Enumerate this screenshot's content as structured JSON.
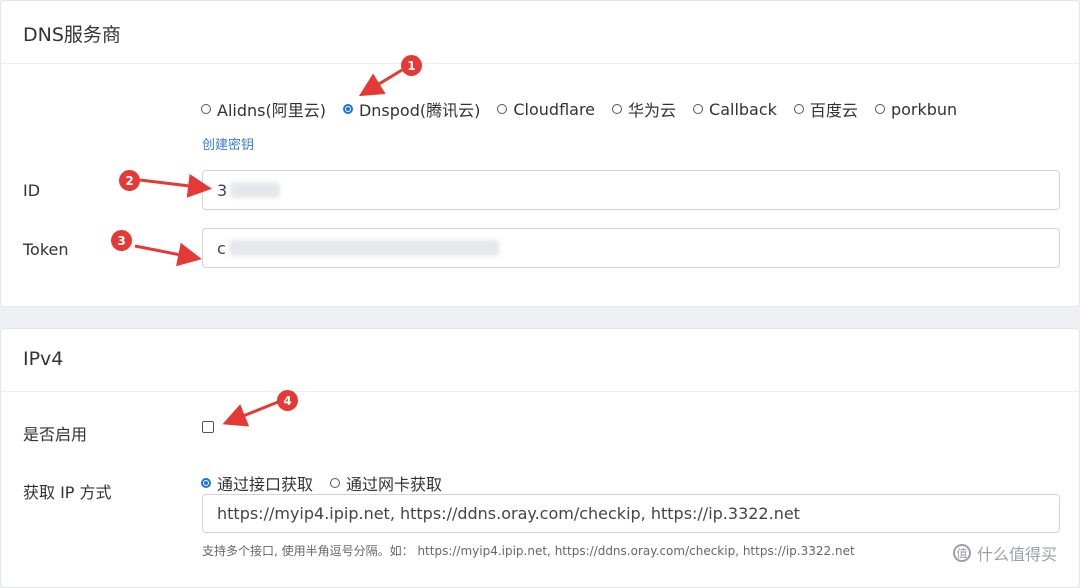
{
  "dns_card": {
    "title": "DNS服务商",
    "providers": [
      {
        "label": "Alidns(阿里云)",
        "checked": false
      },
      {
        "label": "Dnspod(腾讯云)",
        "checked": true
      },
      {
        "label": "Cloudflare",
        "checked": false
      },
      {
        "label": "华为云",
        "checked": false
      },
      {
        "label": "Callback",
        "checked": false
      },
      {
        "label": "百度云",
        "checked": false
      },
      {
        "label": "porkbun",
        "checked": false
      }
    ],
    "create_key_link": "创建密钥",
    "id_label": "ID",
    "id_value": "3",
    "token_label": "Token",
    "token_value": "c"
  },
  "ipv4_card": {
    "title": "IPv4",
    "enable_label": "是否启用",
    "enabled": false,
    "method_label": "获取 IP 方式",
    "methods": [
      {
        "label": "通过接口获取",
        "checked": true
      },
      {
        "label": "通过网卡获取",
        "checked": false
      }
    ],
    "url_value": "https://myip4.ipip.net, https://ddns.oray.com/checkip, https://ip.3322.net",
    "help_text": "支持多个接口, 使用半角逗号分隔。如： https://myip4.ipip.net, https://ddns.oray.com/checkip, https://ip.3322.net"
  },
  "annotations": [
    "1",
    "2",
    "3",
    "4"
  ],
  "watermark": "什么值得买",
  "colors": {
    "accent": "#1a73e8",
    "annotation": "#e53935",
    "link": "#3a7bd5"
  }
}
